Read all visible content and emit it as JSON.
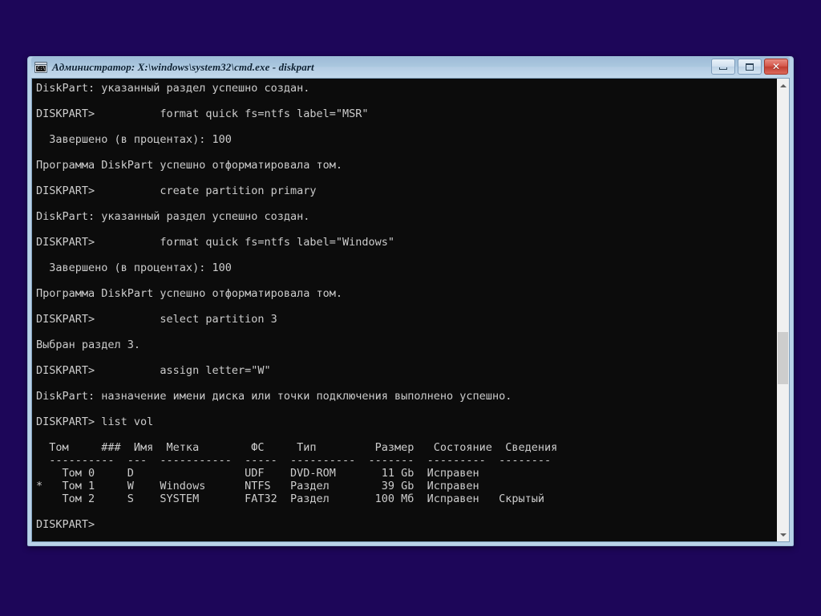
{
  "desktop": {
    "background_color": "#1d0659"
  },
  "window": {
    "title": "Администратор: X:\\windows\\system32\\cmd.exe - diskpart",
    "icon": "cmd-console-icon",
    "icon_text": "C:\\",
    "titlebar_color": "#b4cde4",
    "controls": {
      "minimize_label": "",
      "maximize_label": "",
      "close_label": "✕"
    }
  },
  "console": {
    "background_color": "#0c0c0c",
    "foreground_color": "#cccccc",
    "lines": [
      "DiskPart: указанный раздел успешно создан.",
      "",
      "DISKPART>          format quick fs=ntfs label=\"MSR\"",
      "",
      "  Завершено (в процентах): 100",
      "",
      "Программа DiskPart успешно отформатировала том.",
      "",
      "DISKPART>          create partition primary",
      "",
      "DiskPart: указанный раздел успешно создан.",
      "",
      "DISKPART>          format quick fs=ntfs label=\"Windows\"",
      "",
      "  Завершено (в процентах): 100",
      "",
      "Программа DiskPart успешно отформатировала том.",
      "",
      "DISKPART>          select partition 3",
      "",
      "Выбран раздел 3.",
      "",
      "DISKPART>          assign letter=\"W\"",
      "",
      "DiskPart: назначение имени диска или точки подключения выполнено успешно.",
      "",
      "DISKPART> list vol",
      "",
      "  Том     ###  Имя  Метка        ФС     Тип         Размер   Состояние  Сведения",
      "  ----------  ---  -----------  -----  ----------  -------  ---------  --------",
      "    Том 0     D                 UDF    DVD-ROM       11 Gb  Исправен",
      "*   Том 1     W    Windows      NTFS   Раздел        39 Gb  Исправен",
      "    Том 2     S    SYSTEM       FAT32  Раздел       100 Мб  Исправен   Скрытый",
      "",
      "DISKPART>"
    ],
    "volume_table": {
      "command": "list vol",
      "headers": [
        "Том",
        "###",
        "Имя",
        "Метка",
        "ФС",
        "Тип",
        "Размер",
        "Состояние",
        "Сведения"
      ],
      "rows": [
        {
          "selected": false,
          "marker": "",
          "volume": "Том 0",
          "number": "0",
          "letter": "D",
          "label": "",
          "fs": "UDF",
          "type": "DVD-ROM",
          "size": "11 Gb",
          "status": "Исправен",
          "info": ""
        },
        {
          "selected": true,
          "marker": "*",
          "volume": "Том 1",
          "number": "1",
          "letter": "W",
          "label": "Windows",
          "fs": "NTFS",
          "type": "Раздел",
          "size": "39 Gb",
          "status": "Исправен",
          "info": ""
        },
        {
          "selected": false,
          "marker": "",
          "volume": "Том 2",
          "number": "2",
          "letter": "S",
          "label": "SYSTEM",
          "fs": "FAT32",
          "type": "Раздел",
          "size": "100 Мб",
          "status": "Исправен",
          "info": "Скрытый"
        }
      ]
    },
    "prompt": "DISKPART>"
  },
  "scrollbar": {
    "up_arrow": "▲",
    "down_arrow": "▼",
    "thumb_top_percent": 55,
    "thumb_height_percent": 12
  }
}
